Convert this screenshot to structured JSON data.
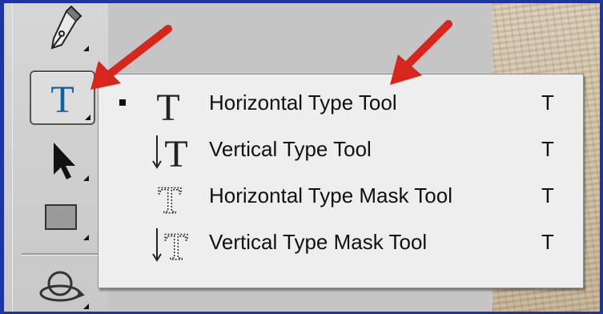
{
  "toolbar": {
    "tools": [
      {
        "icon": "pen-icon"
      },
      {
        "icon": "type-icon",
        "glyph": "T",
        "active": true
      },
      {
        "icon": "arrow-pointer-icon"
      },
      {
        "icon": "rectangle-icon"
      },
      {
        "icon": "3d-rotate-icon"
      }
    ]
  },
  "flyout": {
    "items": [
      {
        "label": "Horizontal Type Tool",
        "shortcut": "T",
        "icon": "horizontal-type-icon",
        "selected": true
      },
      {
        "label": "Vertical Type Tool",
        "shortcut": "T",
        "icon": "vertical-type-icon",
        "selected": false
      },
      {
        "label": "Horizontal Type Mask Tool",
        "shortcut": "T",
        "icon": "horizontal-type-mask-icon",
        "selected": false
      },
      {
        "label": "Vertical Type Mask Tool",
        "shortcut": "T",
        "icon": "vertical-type-mask-icon",
        "selected": false
      }
    ]
  },
  "colors": {
    "border": "#1e33a8",
    "annotation_arrow": "#d7261e",
    "type_glyph": "#0d5fa8"
  }
}
